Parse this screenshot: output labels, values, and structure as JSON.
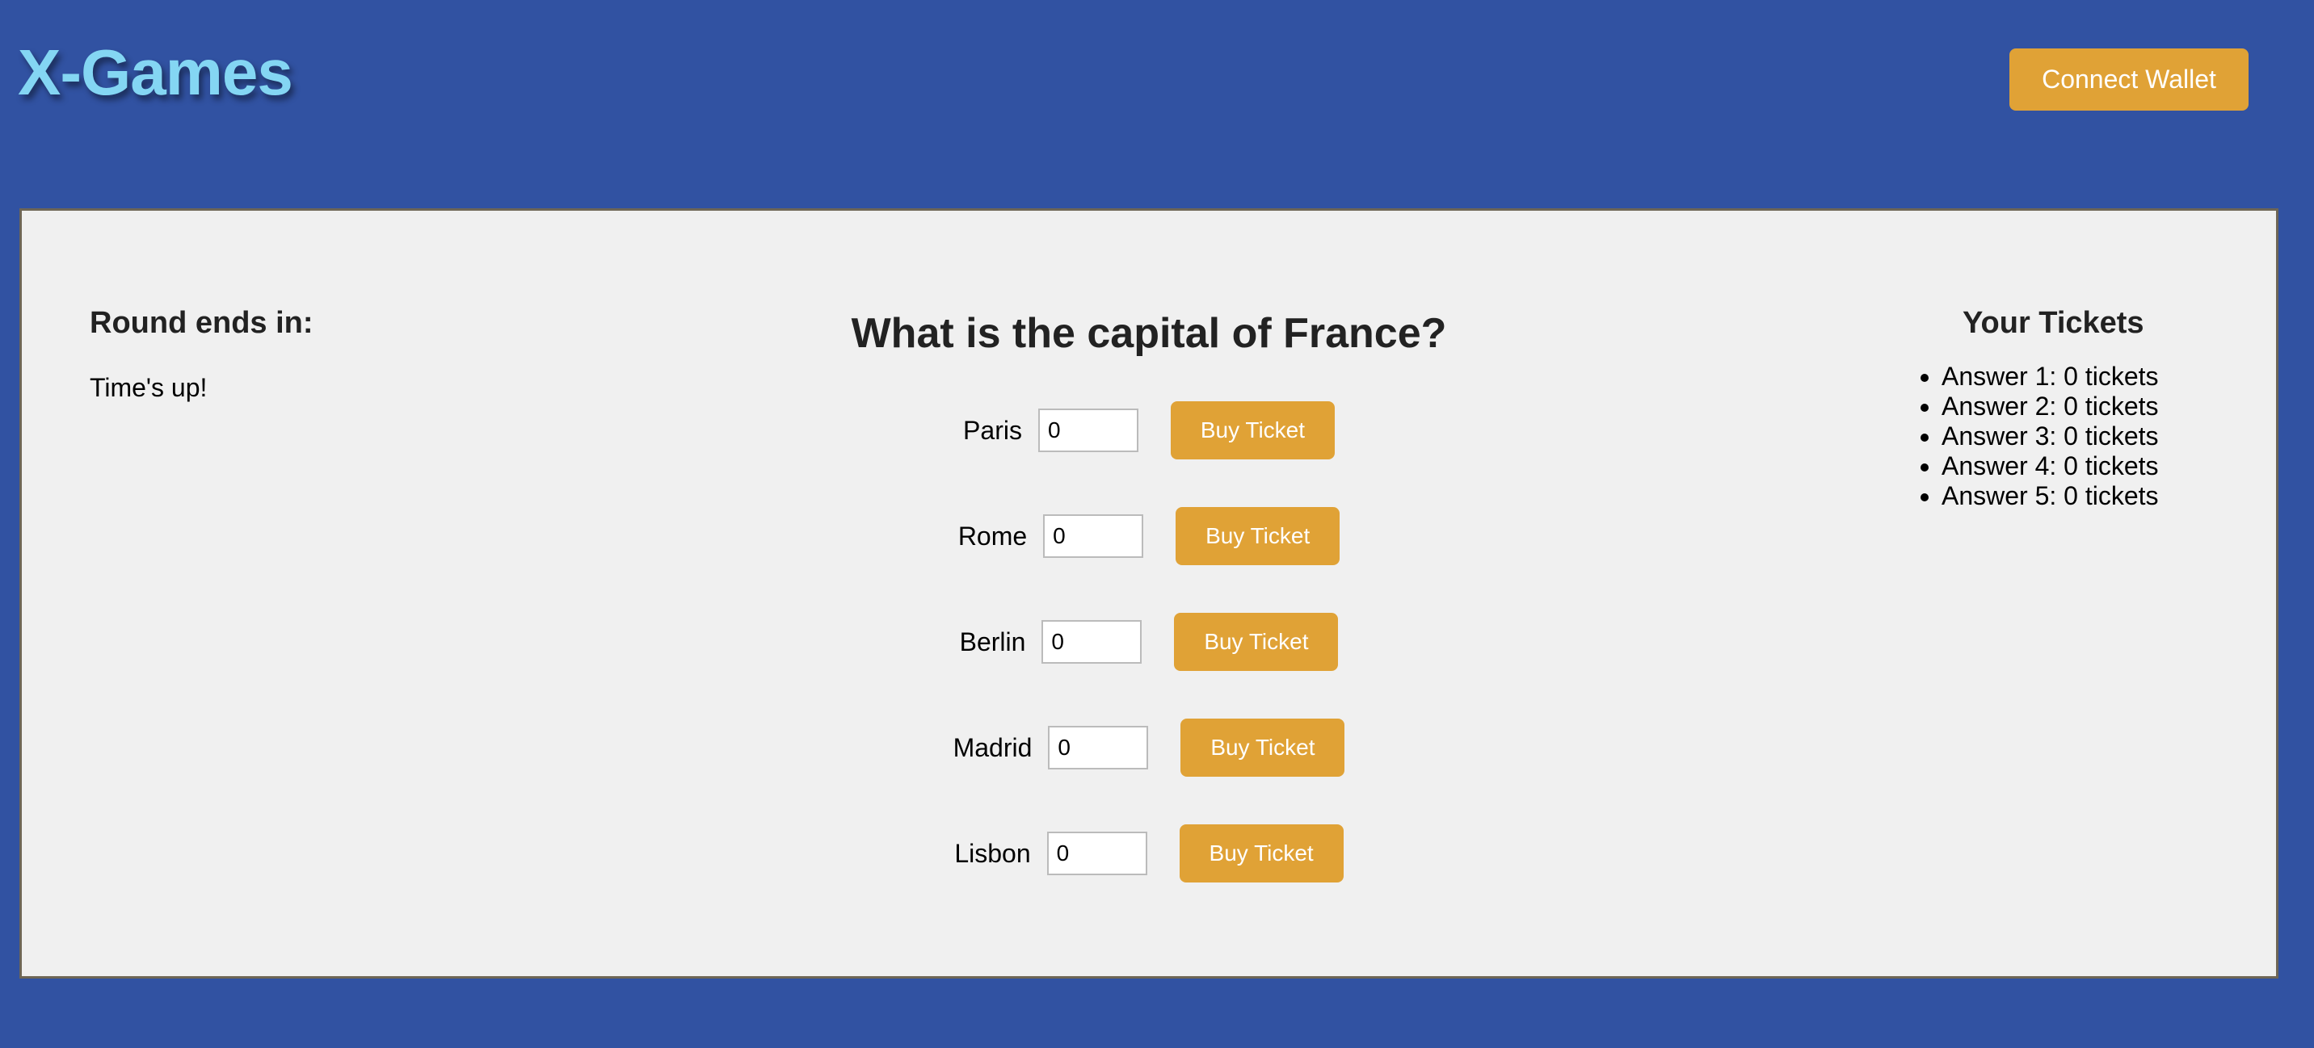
{
  "header": {
    "logo": "X-Games",
    "connect_wallet_label": "Connect Wallet"
  },
  "round": {
    "heading": "Round ends in:",
    "status": "Time's up!"
  },
  "question": {
    "text": "What is the capital of France?",
    "answers": [
      {
        "label": "Paris",
        "value": "0",
        "button": "Buy Ticket"
      },
      {
        "label": "Rome",
        "value": "0",
        "button": "Buy Ticket"
      },
      {
        "label": "Berlin",
        "value": "0",
        "button": "Buy Ticket"
      },
      {
        "label": "Madrid",
        "value": "0",
        "button": "Buy Ticket"
      },
      {
        "label": "Lisbon",
        "value": "0",
        "button": "Buy Ticket"
      }
    ]
  },
  "tickets": {
    "heading": "Your Tickets",
    "items": [
      "Answer 1: 0 tickets",
      "Answer 2: 0 tickets",
      "Answer 3: 0 tickets",
      "Answer 4: 0 tickets",
      "Answer 5: 0 tickets"
    ]
  },
  "colors": {
    "background": "#3152a2",
    "accent": "#e0a236",
    "logo": "#84d6f3",
    "panel": "#f0f0f0"
  }
}
